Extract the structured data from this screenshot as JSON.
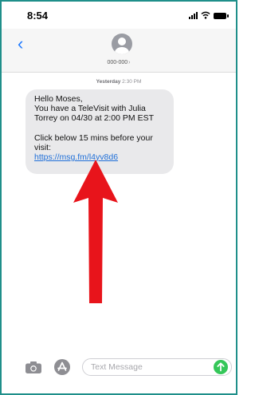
{
  "status_bar": {
    "time": "8:54",
    "icons": [
      "signal-icon",
      "wifi-icon",
      "battery-icon"
    ]
  },
  "header": {
    "back_icon": "chevron-left-icon",
    "avatar_icon": "person-icon",
    "contact_name": "000-000",
    "contact_chevron": "›"
  },
  "conversation": {
    "timestamp_day": "Yesterday",
    "timestamp_time": "2:30 PM",
    "message": {
      "line1": "Hello Moses,",
      "line2": "You have a TeleVisit with Julia",
      "line3": "Torrey on 04/30 at 2:00 PM EST",
      "line4": "Click below 15 mins before your",
      "line5": "visit:",
      "link": "https://msg.fm/l4yv8d6"
    }
  },
  "annotation": {
    "arrow_icon": "red-arrow-up",
    "color": "#e8141b"
  },
  "input_bar": {
    "camera_icon": "camera-icon",
    "apps_icon": "app-store-icon",
    "placeholder": "Text Message",
    "send_icon": "send-arrow-icon",
    "send_color": "#35c759"
  }
}
